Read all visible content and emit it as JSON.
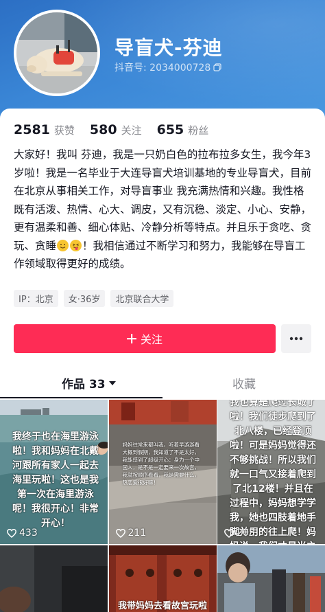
{
  "profile": {
    "nickname": "导盲犬-芬迪",
    "douyin_id_label": "抖音号: 2034000728",
    "avatar_icon": "guide-dog-avatar"
  },
  "stats": [
    {
      "num": "2581",
      "label": "获赞"
    },
    {
      "num": "580",
      "label": "关注"
    },
    {
      "num": "655",
      "label": "粉丝"
    }
  ],
  "bio": {
    "part1": "大家好！我叫 芬迪，我是一只奶白色的拉布拉多女生，我今年3岁啦！我是一名毕业于大连导盲犬培训基地的专业导盲犬，目前在北京从事相关工作，对导盲事业 我充满热情和兴趣。我性格既有活泼、热情、心大、调皮，又有沉稳、淡定、小心、安静，更有温柔和善、细心体贴、冷静分析等特点。并且乐于贪吃、贪玩、贪睡",
    "part2": "！我相信通过不断学习和努力，我能够在导盲工作领域取得更好的成绩。",
    "emoji_1": "smiling-face-emoji",
    "emoji_2": "tongue-out-emoji"
  },
  "tags": [
    "IP：北京",
    "女·36岁",
    "北京联合大学"
  ],
  "actions": {
    "follow_label": "关注",
    "follow_icon": "plus-icon",
    "more_icon": "more-dots-icon",
    "accent": "#fe2c55"
  },
  "tabs": {
    "works_label": "作品 33",
    "works_icon": "caret-down-icon",
    "favorites_label": "收藏"
  },
  "videos": [
    {
      "caption": "我终于也在海里游泳啦！我和妈妈在北戴河跟所有家人一起去海里玩啦！这也是我第一次在海里游泳呢！我很开心！非常开心！",
      "likes": "433"
    },
    {
      "caption": "妈妈往常来都叫我，听着早游游看大概到假期，我知道了不是太好，我能感到了超级开心：身为一个中国人，是不是一定要来一次故宫，我就按顺序看看，我是需要什么，热恋爱很好嘛！",
      "likes": "211"
    },
    {
      "caption": "我也算是爬过长城了啦！我们徒步爬到了北八楼，已经登顶啦！可是妈妈觉得还不够挑战！所以我们就一口气又接着爬到了北12楼！并且在过程中，妈妈想学学我，她也四肢着地手脚并用的往上爬！妈妈说，我们才是当之无愧的，一点不掺水分的好汉！",
      "likes": "205"
    },
    {
      "caption": "",
      "likes": ""
    },
    {
      "caption": "我带妈妈去看故宫玩啦",
      "likes": ""
    },
    {
      "caption": "",
      "likes": ""
    }
  ]
}
